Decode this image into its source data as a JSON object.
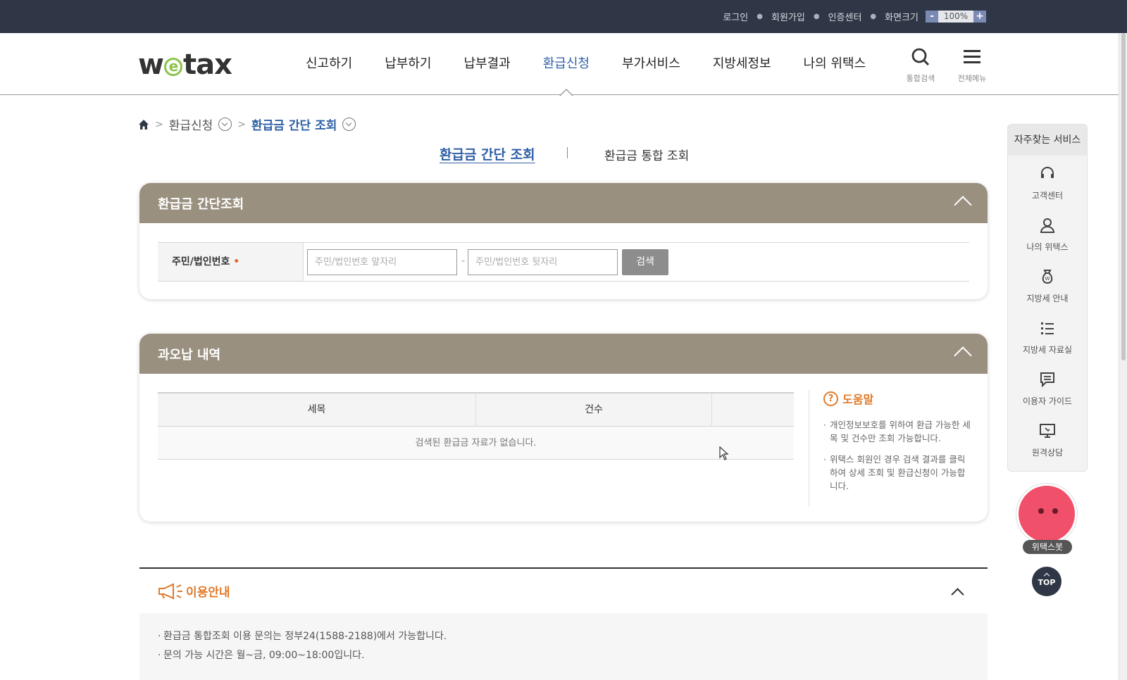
{
  "topbar": {
    "links": [
      "로그인",
      "회원가입",
      "인증센터",
      "화면크기"
    ],
    "zoom": {
      "minus": "-",
      "value": "100%",
      "plus": "+"
    }
  },
  "header": {
    "logo": {
      "pre": "w",
      "mid": "e",
      "post": "tax"
    },
    "nav": [
      "신고하기",
      "납부하기",
      "납부결과",
      "환급신청",
      "부가서비스",
      "지방세정보",
      "나의 위택스"
    ],
    "active_nav": "환급신청",
    "search_label": "통합검색",
    "menu_label": "전체메뉴"
  },
  "breadcrumb": {
    "level1": "환급신청",
    "level2": "환급금 간단 조회"
  },
  "tabs": {
    "active": "환급금 간단 조회",
    "other": "환급금 통합 조회"
  },
  "simple_panel": {
    "title": "환급금 간단조회",
    "field_label": "주민/법인번호",
    "required_mark": "•",
    "front_placeholder": "주민/법인번호 앞자리",
    "dash": "-",
    "back_placeholder": "주민/법인번호 뒷자리",
    "search_button": "검색"
  },
  "overpay_panel": {
    "title": "과오납 내역",
    "columns": [
      "세목",
      "건수",
      ""
    ],
    "empty_message": "검색된 환급금 자료가 없습니다.",
    "help": {
      "icon": "?",
      "title": "도움말",
      "items": [
        "개인정보보호를 위하여 환급 가능한 세목 및 건수만 조회 가능합니다.",
        "위택스 회원인 경우 검색 결과를 클릭하여 상세 조회 및 환급신청이 가능합니다."
      ]
    }
  },
  "info_section": {
    "title": "이용안내",
    "items": [
      "환급금 통합조회 이용 문의는 정부24(1588-2188)에서 가능합니다.",
      "문의 가능 시간은 월~금, 09:00~18:00입니다."
    ]
  },
  "quick_menu": {
    "title": "자주찾는 서비스",
    "items": [
      {
        "label": "고객센터",
        "icon": "headset-icon"
      },
      {
        "label": "나의 위택스",
        "icon": "user-icon"
      },
      {
        "label": "지방세 안내",
        "icon": "money-bag-icon"
      },
      {
        "label": "지방세 자료실",
        "icon": "list-icon"
      },
      {
        "label": "이용자 가이드",
        "icon": "chat-icon"
      },
      {
        "label": "원격상담",
        "icon": "monitor-icon"
      }
    ]
  },
  "chatbot_label": "위택스봇",
  "top_button": "TOP",
  "colors": {
    "topbar": "#2f3646",
    "accent_blue": "#2e5fa6",
    "panel_header": "#9a9080",
    "orange": "#e07a2a"
  }
}
